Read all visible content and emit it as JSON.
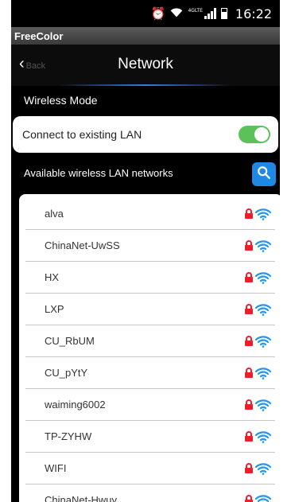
{
  "status_bar": {
    "time": "16:22",
    "network_label": "4GLTE",
    "icons": [
      "alarm-icon",
      "wifi-icon",
      "signal-icon",
      "battery-icon"
    ]
  },
  "app": {
    "name": "FreeColor"
  },
  "nav": {
    "back_label": "Back",
    "title": "Network"
  },
  "wireless_mode": {
    "label": "Wireless Mode"
  },
  "lan": {
    "label": "Connect to existing LAN",
    "enabled": true
  },
  "available": {
    "label": "Available wireless LAN networks"
  },
  "networks": [
    {
      "name": "alva"
    },
    {
      "name": "ChinaNet-UwSS"
    },
    {
      "name": "HX"
    },
    {
      "name": "LXP"
    },
    {
      "name": "CU_RbUM"
    },
    {
      "name": "CU_pYtY"
    },
    {
      "name": "waiming6002"
    },
    {
      "name": "TP-ZYHW"
    },
    {
      "name": "WIFI"
    },
    {
      "name": "ChinaNet-Hwuy"
    }
  ],
  "colors": {
    "toggle_on": "#5cc159",
    "search_button": "#1e88e5",
    "lock": "#e8202a",
    "wifi_signal": "#2196f3"
  }
}
